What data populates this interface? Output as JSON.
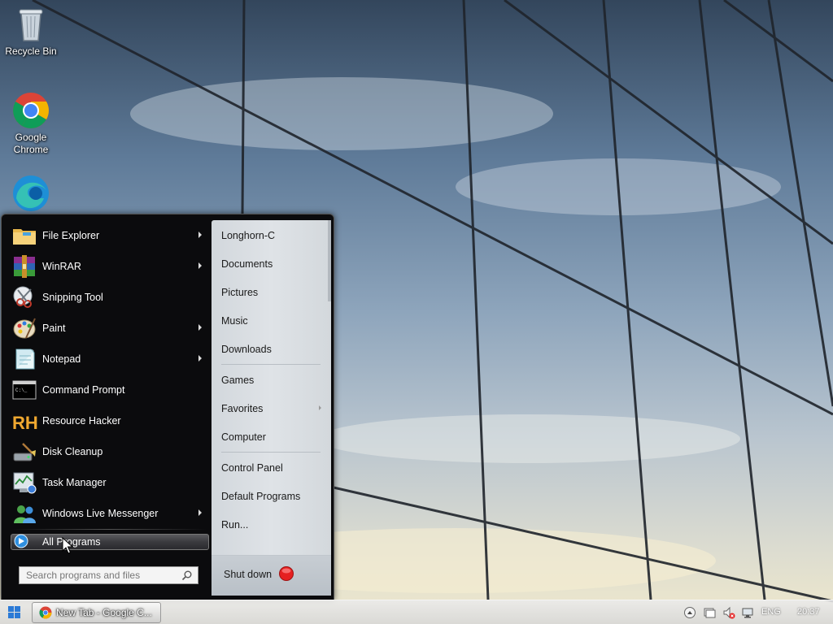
{
  "desktop": {
    "icons": [
      {
        "label": "Recycle Bin",
        "icon": "recycle-bin-icon"
      },
      {
        "label": "Google\nChrome",
        "icon": "chrome-icon"
      },
      {
        "label": "",
        "icon": "edge-icon"
      }
    ]
  },
  "start_menu": {
    "programs": [
      {
        "label": "File Explorer",
        "icon": "folder-icon",
        "submenu": true
      },
      {
        "label": "WinRAR",
        "icon": "winrar-icon",
        "submenu": true
      },
      {
        "label": "Snipping Tool",
        "icon": "scissors-icon",
        "submenu": false
      },
      {
        "label": "Paint",
        "icon": "paint-palette-icon",
        "submenu": true
      },
      {
        "label": "Notepad",
        "icon": "notepad-icon",
        "submenu": true
      },
      {
        "label": "Command Prompt",
        "icon": "terminal-icon",
        "submenu": false
      },
      {
        "label": "Resource Hacker",
        "icon": "rh-icon",
        "submenu": false
      },
      {
        "label": "Disk Cleanup",
        "icon": "disk-cleanup-icon",
        "submenu": false
      },
      {
        "label": "Task Manager",
        "icon": "task-manager-icon",
        "submenu": false
      },
      {
        "label": "Windows Live Messenger",
        "icon": "messenger-icon",
        "submenu": true
      }
    ],
    "all_programs_label": "All Programs",
    "search_placeholder": "Search programs and files",
    "places": [
      {
        "label": "Longhorn-C"
      },
      {
        "label": "Documents"
      },
      {
        "label": "Pictures"
      },
      {
        "label": "Music"
      },
      {
        "label": "Downloads"
      },
      {
        "label": "Games"
      },
      {
        "label": "Favorites",
        "submenu": true
      },
      {
        "label": "Computer"
      },
      {
        "label": "Control Panel"
      },
      {
        "label": "Default Programs"
      },
      {
        "label": "Run..."
      }
    ],
    "shutdown_label": "Shut down"
  },
  "taskbar": {
    "window_title": "New Tab - Google C...",
    "language": "ENG",
    "clock": "20:37"
  },
  "colors": {
    "menu_bg": "#0b0b0d",
    "places_bg": "#dfe3e7",
    "shutdown_red": "#e52020"
  }
}
